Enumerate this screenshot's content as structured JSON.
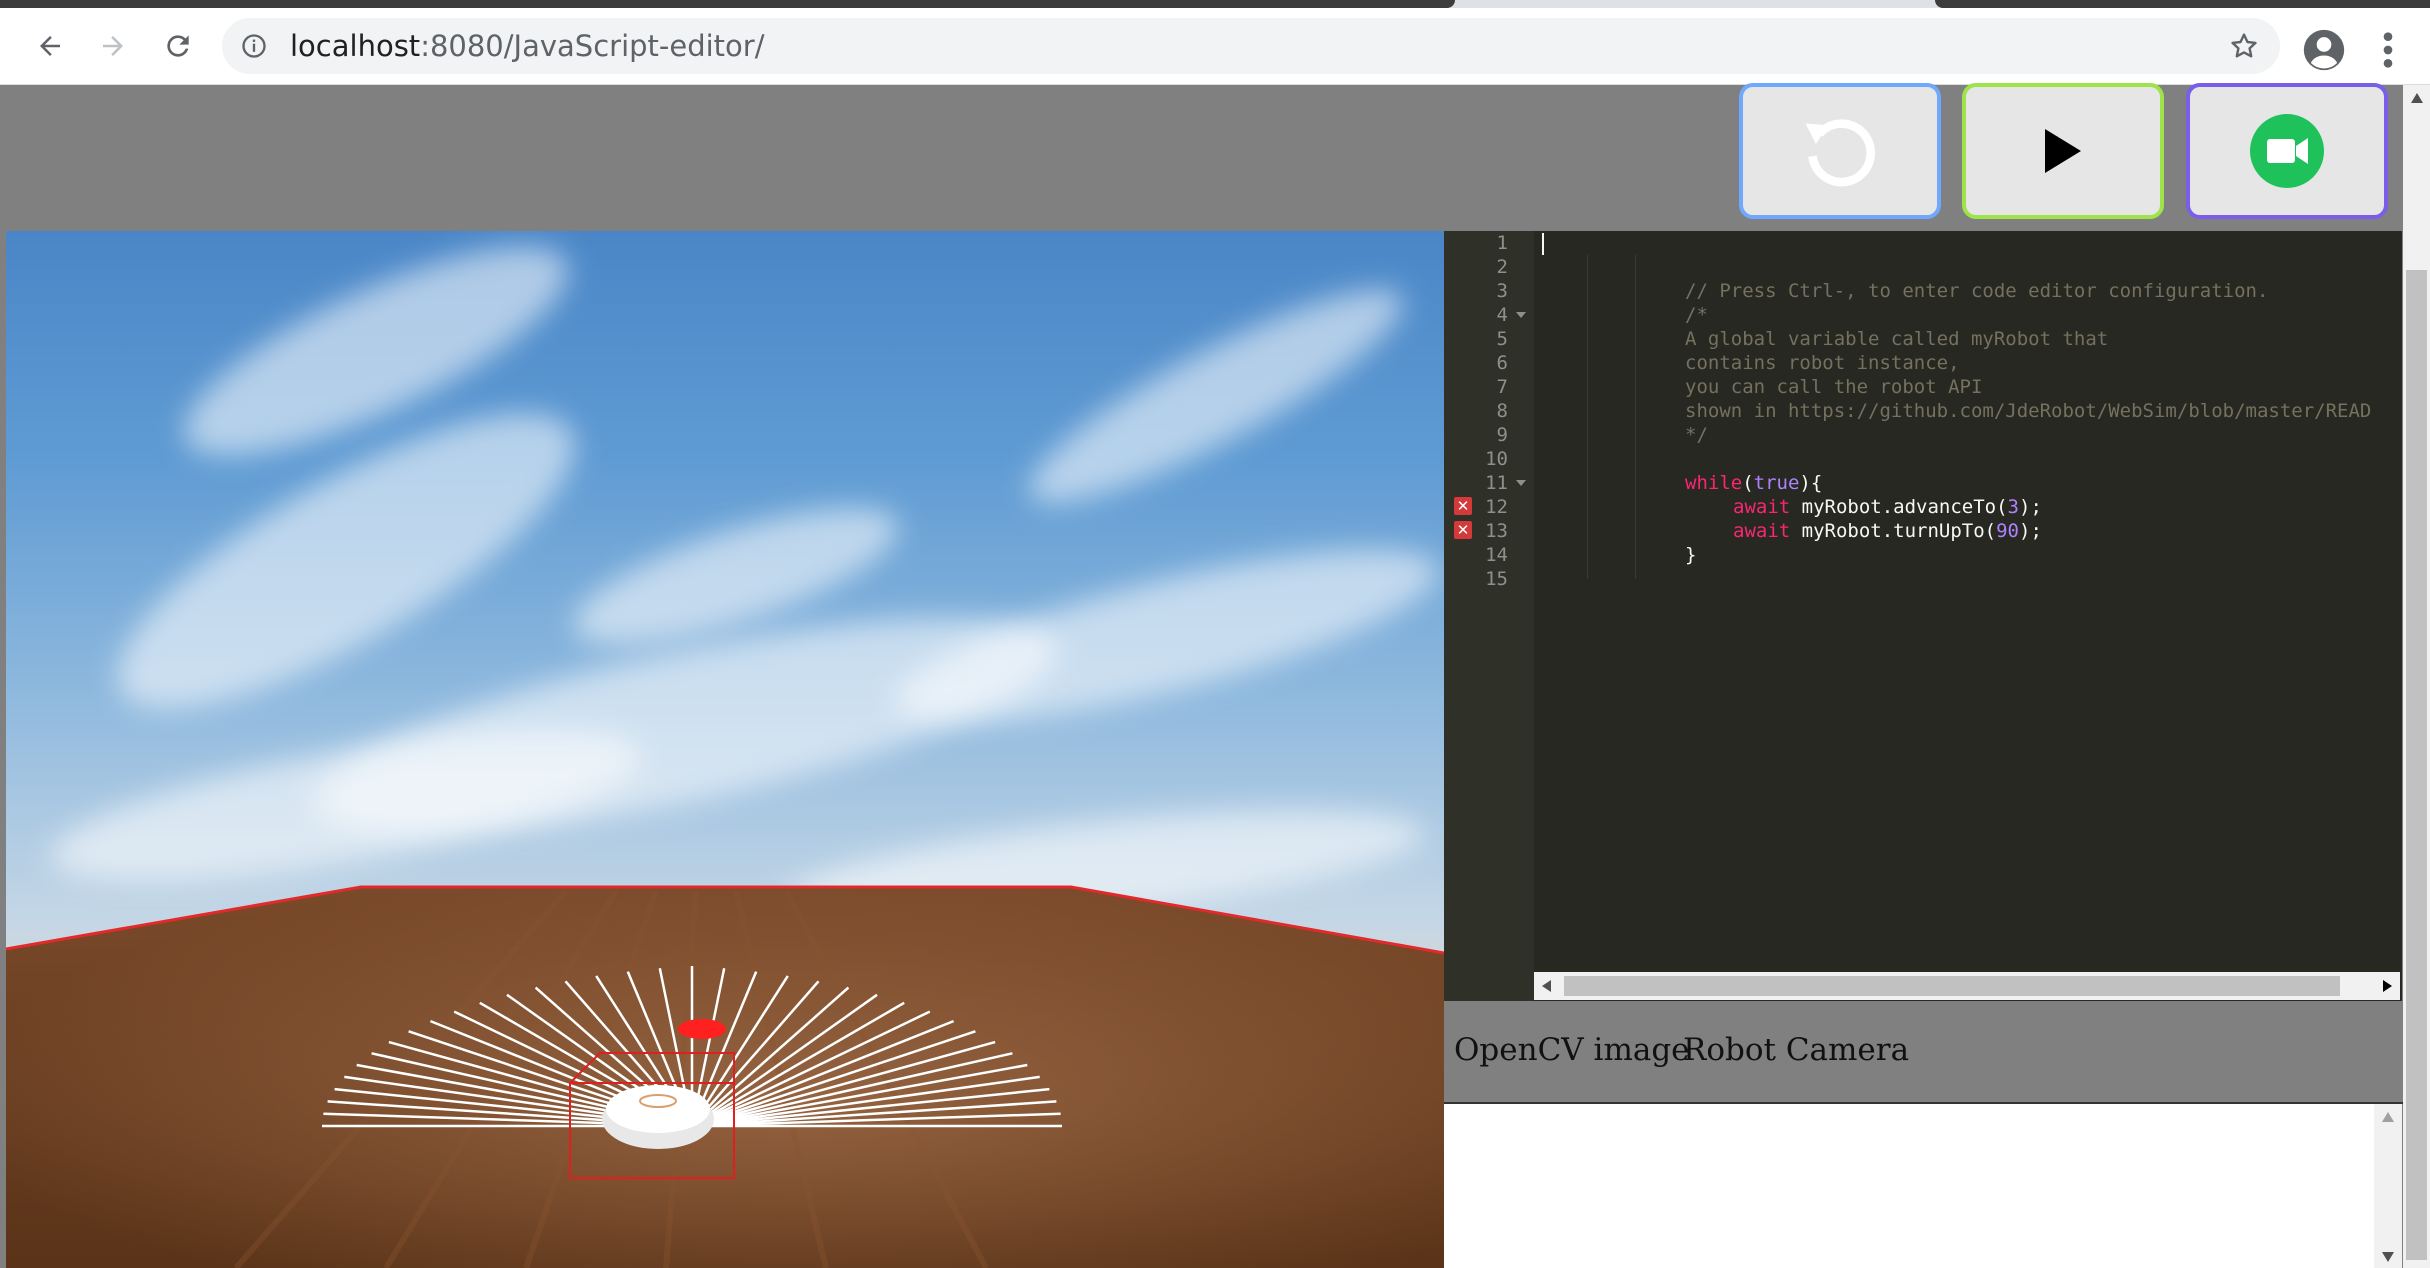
{
  "browser": {
    "url_host": "localhost",
    "url_rest": ":8080/JavaScript-editor/"
  },
  "editor": {
    "line_numbers": [
      "1",
      "2",
      "3",
      "4",
      "5",
      "6",
      "7",
      "8",
      "9",
      "10",
      "11",
      "12",
      "13",
      "14",
      "15"
    ],
    "lines": {
      "l3": "// Press Ctrl-, to enter code editor configuration.",
      "l4": "/*",
      "l5": "A global variable called myRobot that",
      "l6": "contains robot instance,",
      "l7": "you can call the robot API",
      "l8": "shown in https://github.com/JdeRobot/WebSim/blob/master/READ",
      "l9": "*/",
      "l11_kw": "while",
      "l11_open": "(",
      "l11_val": "true",
      "l11_close": "){",
      "l12_kw": "await",
      "l12_mid": " myRobot.advanceTo(",
      "l12_num": "3",
      "l12_end": ");",
      "l13_kw": "await",
      "l13_mid": " myRobot.turnUpTo(",
      "l13_num": "90",
      "l13_end": ");",
      "l14": "}"
    },
    "error_marker": "✕",
    "error_lines": [
      "12",
      "13"
    ]
  },
  "tabs": {
    "opencv": "OpenCV image",
    "camera": "Robot Camera"
  },
  "colors": {
    "reset_border": "#6fa8ff",
    "play_border": "#9fe34a",
    "record_border": "#7a5de8",
    "record_icon": "#1fc25a",
    "editor_bg": "#272822"
  },
  "icons": {
    "back": "arrow-left-icon",
    "forward": "arrow-right-icon",
    "reload": "reload-icon",
    "info": "info-icon",
    "star": "star-icon",
    "profile": "account-icon",
    "menu": "kebab-menu-icon",
    "reset": "reset-icon",
    "play": "play-icon",
    "record": "video-camera-icon"
  }
}
